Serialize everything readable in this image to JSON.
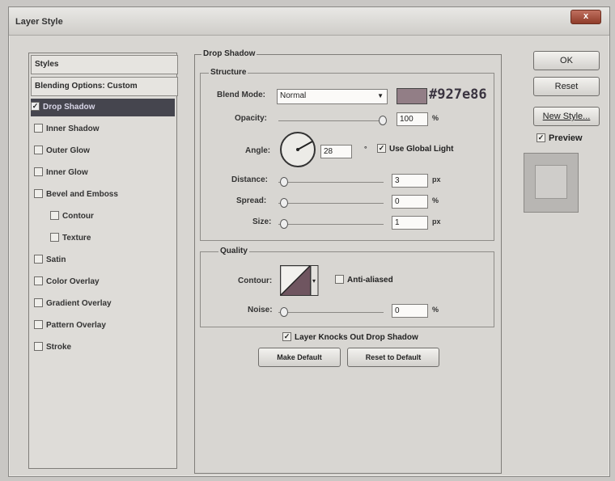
{
  "window": {
    "title": "Layer Style",
    "close": "x"
  },
  "styles_list": {
    "header": "Styles",
    "blending": "Blending Options: Custom",
    "items": [
      {
        "label": "Drop Shadow",
        "checked": true,
        "selected": true
      },
      {
        "label": "Inner Shadow",
        "checked": false
      },
      {
        "label": "Outer Glow",
        "checked": false
      },
      {
        "label": "Inner Glow",
        "checked": false
      },
      {
        "label": "Bevel and Emboss",
        "checked": false
      },
      {
        "label": "Contour",
        "checked": false
      },
      {
        "label": "Texture",
        "checked": false
      },
      {
        "label": "Satin",
        "checked": false
      },
      {
        "label": "Color Overlay",
        "checked": false
      },
      {
        "label": "Gradient Overlay",
        "checked": false
      },
      {
        "label": "Pattern Overlay",
        "checked": false
      },
      {
        "label": "Stroke",
        "checked": false
      }
    ]
  },
  "drop_shadow": {
    "title": "Drop Shadow",
    "structure": {
      "title": "Structure",
      "blend_mode_label": "Blend Mode:",
      "blend_mode_value": "Normal",
      "color_swatch": "#927e86",
      "color_label": "#927e86",
      "opacity_label": "Opacity:",
      "opacity_value": "100",
      "opacity_unit": "%",
      "angle_label": "Angle:",
      "angle_value": "28",
      "angle_unit": "°",
      "use_global_light": "Use Global Light",
      "distance_label": "Distance:",
      "distance_value": "3",
      "distance_unit": "px",
      "spread_label": "Spread:",
      "spread_value": "0",
      "spread_unit": "%",
      "size_label": "Size:",
      "size_value": "1",
      "size_unit": "px"
    },
    "quality": {
      "title": "Quality",
      "contour_label": "Contour:",
      "anti_aliased": "Anti-aliased",
      "noise_label": "Noise:",
      "noise_value": "0",
      "noise_unit": "%"
    },
    "knockout": "Layer Knocks Out Drop Shadow",
    "make_default": "Make Default",
    "reset_default": "Reset to Default"
  },
  "buttons": {
    "ok": "OK",
    "reset": "Reset",
    "new_style": "New Style...",
    "preview": "Preview"
  },
  "colors": {
    "shadow": "#927e86",
    "selected_row": "#45454e"
  }
}
